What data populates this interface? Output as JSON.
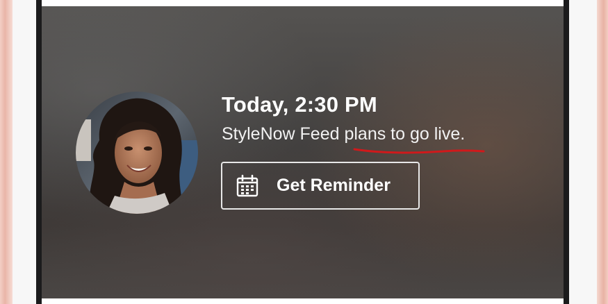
{
  "notification": {
    "time": "Today, 2:30 PM",
    "subtitle_prefix": "StyleNow Feed ",
    "subtitle_highlight": "plans to go live",
    "subtitle_suffix": ".",
    "button_label": "Get Reminder",
    "button_icon": "calendar-icon",
    "avatar_icon": "profile-photo"
  },
  "colors": {
    "phone_frame": "#e9b5a8",
    "annotation_underline": "#d0191b",
    "card_background": "#454240",
    "text": "#ffffff"
  }
}
